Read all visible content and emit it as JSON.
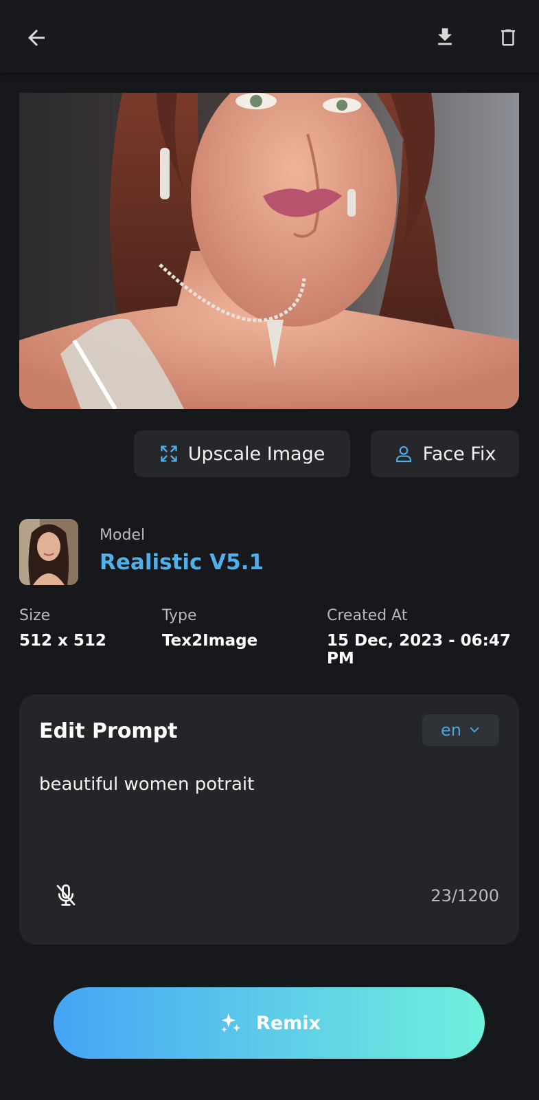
{
  "header": {
    "back_icon": "arrow-left-icon",
    "download_icon": "download-icon",
    "delete_icon": "trash-icon"
  },
  "actions": {
    "upscale_label": "Upscale Image",
    "upscale_icon": "expand-arrows-icon",
    "facefix_label": "Face Fix",
    "facefix_icon": "person-icon"
  },
  "model": {
    "label": "Model",
    "name": "Realistic V5.1"
  },
  "details": {
    "size_label": "Size",
    "size_value": "512 x 512",
    "type_label": "Type",
    "type_value": "Tex2Image",
    "created_label": "Created At",
    "created_value": "15 Dec, 2023 - 06:47 PM"
  },
  "prompt": {
    "title": "Edit Prompt",
    "language": "en",
    "text": "beautiful women potrait",
    "char_count": "23/1200",
    "mic_icon": "mic-off-icon"
  },
  "remix": {
    "label": "Remix",
    "icon": "sparkles-icon"
  },
  "colors": {
    "background": "#16181b",
    "accent_blue": "#4fb0ea",
    "gradient_start": "#46a4f5",
    "gradient_end": "#6ff0dc",
    "card": "#242528"
  }
}
